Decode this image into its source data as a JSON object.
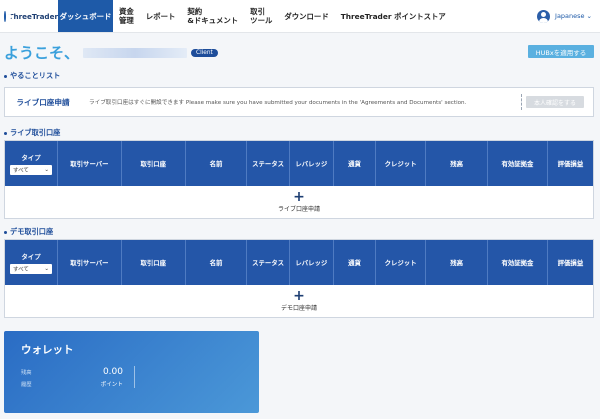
{
  "nav": {
    "logo": "ThreeTrader",
    "items": [
      {
        "id": "dashboard",
        "lines": [
          "ダッシュボード"
        ],
        "active": true
      },
      {
        "id": "funds",
        "lines": [
          "資金",
          "管理"
        ]
      },
      {
        "id": "report",
        "lines": [
          "レポート"
        ]
      },
      {
        "id": "contract",
        "lines": [
          "契約",
          "&ドキュメント"
        ]
      },
      {
        "id": "tools",
        "lines": [
          "取引",
          "ツール"
        ]
      },
      {
        "id": "download",
        "lines": [
          "ダウンロード"
        ]
      },
      {
        "id": "pointstore",
        "lines": [
          "ThreeTrader ポイントストア"
        ]
      }
    ],
    "language": "Japanese"
  },
  "welcome": {
    "greeting": "ようこそ、",
    "badge": "Client",
    "hubx_button": "HUBxを適用する"
  },
  "todo": {
    "title": "やることリスト",
    "label": "ライブ口座申請",
    "message": "ライブ取引口座はすぐに開設できます Please make sure you have submitted your documents in the 'Agreements and Documents' section.",
    "button": "本人確認をする"
  },
  "live": {
    "title": "ライブ取引口座",
    "type_label": "タイプ",
    "select_value": "すべて",
    "columns": [
      "取引サーバー",
      "取引口座",
      "名前",
      "ステータス",
      "レバレッジ",
      "通貨",
      "クレジット",
      "残高",
      "有効証拠金",
      "評価損益"
    ],
    "add_label": "ライブ口座申請"
  },
  "demo": {
    "title": "デモ取引口座",
    "type_label": "タイプ",
    "select_value": "すべて",
    "columns": [
      "取引サーバー",
      "取引口座",
      "名前",
      "ステータス",
      "レバレッジ",
      "通貨",
      "クレジット",
      "残高",
      "有効証拠金",
      "評価損益"
    ],
    "add_label": "デモ口座申請"
  },
  "wallet": {
    "title": "ウォレット",
    "row1": "残高",
    "row2": "履歴",
    "value": "0.00",
    "unit": "ポイント"
  },
  "colors": {
    "primary": "#2456a8",
    "accent": "#3aa0dc"
  }
}
